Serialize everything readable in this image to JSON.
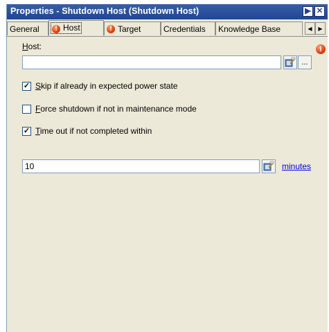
{
  "window": {
    "title": "Properties - Shutdown Host (Shutdown Host)",
    "title_buttons": {
      "pin_glyph": "▶",
      "close_glyph": "✕"
    }
  },
  "tabs": [
    {
      "label": "General",
      "active": false,
      "error": false
    },
    {
      "label": "Host",
      "active": true,
      "error": true
    },
    {
      "label": "Target",
      "active": false,
      "error": true
    },
    {
      "label": "Credentials",
      "active": false,
      "error": false
    },
    {
      "label": "Knowledge Base",
      "active": false,
      "error": false
    }
  ],
  "tab_scroll": {
    "left_glyph": "◀",
    "right_glyph": "▶"
  },
  "host": {
    "label_prefix": "H",
    "label_rest": "ost:",
    "value": "",
    "browse_label": "...",
    "error_glyph": "!"
  },
  "options": {
    "skip_power_state": {
      "mnemonic": "S",
      "rest": "kip if already in expected power state",
      "checked": true
    },
    "force_shutdown": {
      "mnemonic": "F",
      "rest": "orce shutdown if not in maintenance mode",
      "checked": false
    },
    "timeout": {
      "mnemonic": "T",
      "rest": "ime out if not completed within",
      "checked": true
    }
  },
  "timeout_value": "10",
  "timeout_unit": "minutes",
  "icons": {
    "tab_error": "error-icon",
    "variable_picker": "variable-picker-icon",
    "check": "✓"
  },
  "colors": {
    "titlebar": "#2a4f9e",
    "panel": "#ece9d8",
    "error": "#e2400f",
    "link": "#0000ee"
  }
}
